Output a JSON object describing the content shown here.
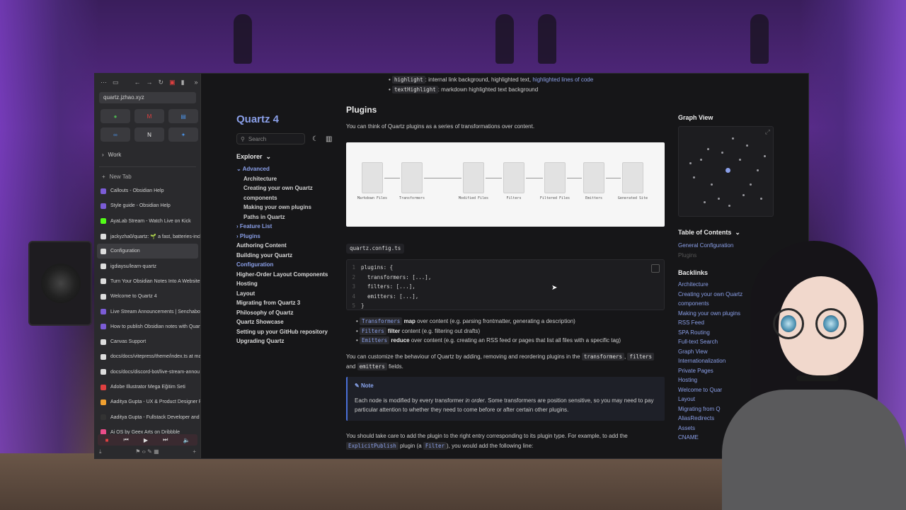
{
  "browser": {
    "url": "quartz.jzhao.xyz",
    "folder": "Work",
    "new_tab": "New Tab",
    "tabs": [
      {
        "label": "Callouts - Obsidian Help",
        "color": "#7b5cd6"
      },
      {
        "label": "Style guide - Obsidian Help",
        "color": "#7b5cd6"
      },
      {
        "label": "AyaLab Stream - Watch Live on Kick",
        "color": "#53fc18"
      },
      {
        "label": "jackyzha0/quartz: 🌱 a fast, batteries-inclu",
        "color": "#dddddd"
      },
      {
        "label": "Configuration",
        "color": "#dddddd"
      },
      {
        "label": "igdiaysu/learn-quartz",
        "color": "#dddddd"
      },
      {
        "label": "Turn Your Obsidian Notes Into A Website",
        "color": "#dddddd"
      },
      {
        "label": "Welcome to Quartz 4",
        "color": "#dddddd"
      },
      {
        "label": "Live Stream Announcements | Senchabot",
        "color": "#7b5cd6"
      },
      {
        "label": "How to publish Obsidian notes with Quartz",
        "color": "#7b5cd6"
      },
      {
        "label": "Canvas Support",
        "color": "#dddddd"
      },
      {
        "label": "docs/docs/vitepress/theme/index.ts at ma",
        "color": "#dddddd"
      },
      {
        "label": "docs/docs/discord-bot/live-stream-annou",
        "color": "#dddddd"
      },
      {
        "label": "Adobe Illustrator Mega Eğitim Seti",
        "color": "#e04040"
      },
      {
        "label": "Aaditya Gupta - UX & Product Designer P",
        "color": "#f0a030"
      },
      {
        "label": "Aaditya Gupta - Fullstack Developer and D",
        "color": "#333333"
      },
      {
        "label": "Ai OS by Geex Arts on Dribbble",
        "color": "#ea4c89"
      }
    ]
  },
  "site": {
    "title": "Quartz 4",
    "search_placeholder": "Search",
    "explorer": "Explorer",
    "tree": [
      {
        "label": "Advanced",
        "kind": "folder"
      },
      {
        "label": "Architecture",
        "kind": "sub"
      },
      {
        "label": "Creating your own Quartz",
        "kind": "sub"
      },
      {
        "label": "components",
        "kind": "sub"
      },
      {
        "label": "Making your own plugins",
        "kind": "sub"
      },
      {
        "label": "Paths in Quartz",
        "kind": "sub"
      },
      {
        "label": "Feature List",
        "kind": "folder"
      },
      {
        "label": "Plugins",
        "kind": "folder"
      },
      {
        "label": "Authoring Content",
        "kind": "item"
      },
      {
        "label": "Building your Quartz",
        "kind": "item"
      },
      {
        "label": "Configuration",
        "kind": "cur"
      },
      {
        "label": "Higher-Order Layout Components",
        "kind": "item"
      },
      {
        "label": "Hosting",
        "kind": "item"
      },
      {
        "label": "Layout",
        "kind": "item"
      },
      {
        "label": "Migrating from Quartz 3",
        "kind": "item"
      },
      {
        "label": "Philosophy of Quartz",
        "kind": "item"
      },
      {
        "label": "Quartz Showcase",
        "kind": "item"
      },
      {
        "label": "Setting up your GitHub repository",
        "kind": "item"
      },
      {
        "label": "Upgrading Quartz",
        "kind": "item"
      }
    ]
  },
  "article": {
    "bullet1_code": "highlight",
    "bullet1_text": ": internal link background, highlighted text,",
    "bullet1_link": "highlighted lines of code",
    "bullet2_code": "textHighlight",
    "bullet2_text": ": markdown highlighted text background",
    "heading": "Plugins",
    "intro": "You can think of Quartz plugins as a series of transformations over content.",
    "diagram_labels": [
      "Markdown Files",
      "Transformers",
      "Modified Files",
      "Filters",
      "Filtered Files",
      "Emitters",
      "Generated Site"
    ],
    "file_tag": "quartz.config.ts",
    "code": [
      {
        "n": "1",
        "t": "plugins: {"
      },
      {
        "n": "2",
        "t": "  transformers: [...],"
      },
      {
        "n": "3",
        "t": "  filters: [...],"
      },
      {
        "n": "4",
        "t": "  emitters: [...],"
      },
      {
        "n": "5",
        "t": "}"
      }
    ],
    "list": [
      {
        "code": "Transformers",
        "verb": "map",
        "rest": "over content (e.g. parsing frontmatter, generating a description)"
      },
      {
        "code": "Filters",
        "verb": "filter",
        "rest": "content (e.g. filtering out drafts)"
      },
      {
        "code": "Emitters",
        "verb": "reduce",
        "rest": "over content (e.g. creating an RSS feed or pages that list all files with a specific tag)"
      }
    ],
    "p2_a": "You can customize the behaviour of Quartz by adding, removing and reordering plugins in the",
    "p2_c1": "transformers",
    "p2_c2": "filters",
    "p2_and": "and",
    "p2_c3": "emitters",
    "p2_b": "fields.",
    "note_title": "Note",
    "note_a": "Each node is modified by every transformer",
    "note_em": "in order",
    "note_b": ". Some transformers are position sensitive, so you may need to pay particular attention to whether they need to come before or after certain other plugins.",
    "p3_a": "You should take care to add the plugin to the right entry corresponding to its plugin type. For example, to add the",
    "p3_code": "ExplicitPublish",
    "p3_b": "plugin (a",
    "p3_code2": "Filter",
    "p3_c": "), you would add the following line:"
  },
  "right": {
    "graph_title": "Graph View",
    "toc_title": "Table of Contents",
    "toc": [
      "General Configuration",
      "Plugins"
    ],
    "backlinks_title": "Backlinks",
    "backlinks": [
      "Architecture",
      "Creating your own Quartz",
      "components",
      "Making your own plugins",
      "RSS Feed",
      "SPA Routing",
      "Full-text Search",
      "Graph View",
      "Internationalization",
      "Private Pages",
      "Hosting",
      "Welcome to Quar",
      "Layout",
      "Migrating from  Q",
      "AliasRedirects",
      "Assets",
      "CNAME"
    ]
  }
}
